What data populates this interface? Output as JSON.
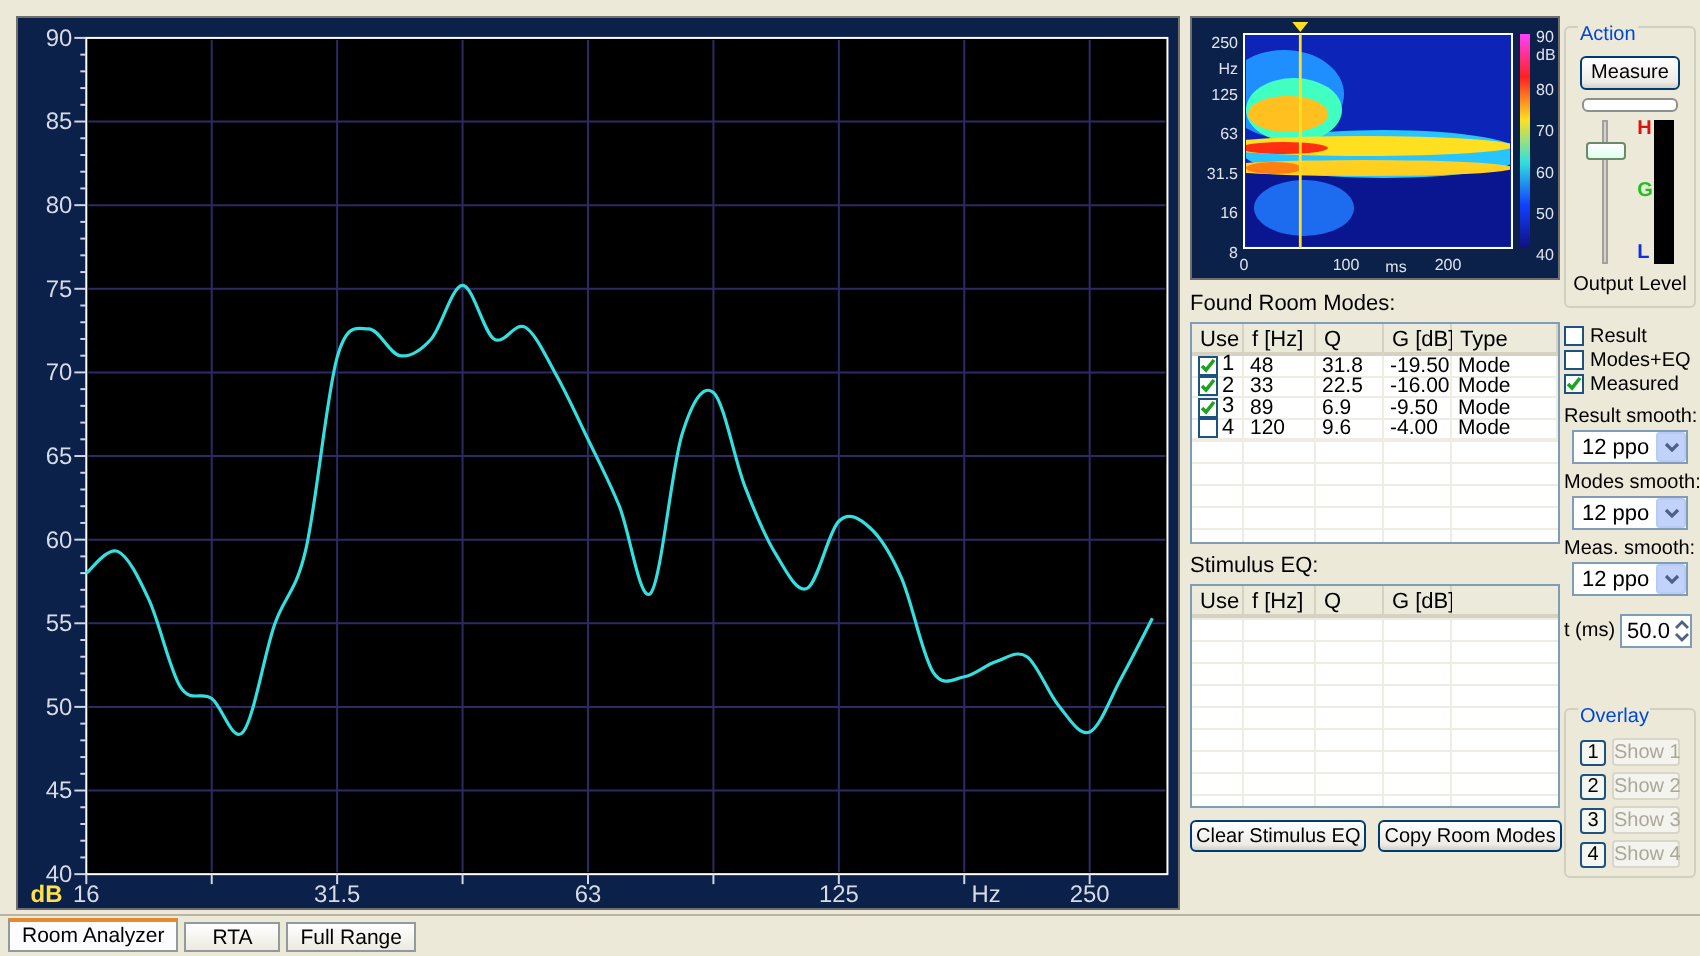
{
  "chart": {
    "chart_data": {
      "type": "line",
      "grid": true,
      "xlabel": "Hz",
      "ylabel": "dB",
      "ylim": [
        40,
        90
      ],
      "yticks": [
        40,
        45,
        50,
        55,
        60,
        65,
        70,
        75,
        80,
        85,
        90
      ],
      "categories": [
        "16",
        null,
        null,
        null,
        null,
        null,
        null,
        null,
        "31.5",
        null,
        null,
        null,
        null,
        null,
        null,
        null,
        "63",
        null,
        null,
        null,
        null,
        null,
        null,
        null,
        "125",
        null,
        null,
        null,
        null,
        null,
        null,
        null,
        "250",
        null,
        null
      ],
      "series": [
        {
          "color": "#33e0e0",
          "values": [
            58,
            59.3,
            56.4,
            51.2,
            50.5,
            48.5,
            54.9,
            59.4,
            70.9,
            72.6,
            71,
            72,
            75.2,
            72,
            72.7,
            69.8,
            66,
            62,
            56.8,
            66.3,
            68.8,
            63.2,
            59.1,
            57.1,
            61.1,
            60.7,
            57.7,
            52.1,
            51.8,
            52.7,
            53,
            50.1,
            48.5,
            51.7,
            55.3
          ]
        }
      ]
    }
  },
  "spectrogram": {
    "y_unit": "Hz",
    "y_ticks": [
      "250",
      "125",
      "63",
      "31.5",
      "16",
      "8"
    ],
    "x_ticks": [
      "0",
      "100",
      "200"
    ],
    "x_unit": "ms",
    "colorbar_unit": "dB",
    "colorbar_ticks": [
      "90",
      "80",
      "70",
      "60",
      "50",
      "40"
    ],
    "cursor": {
      "level": 0.21
    }
  },
  "found_modes": {
    "title": "Found Room Modes:",
    "columns": [
      "Use",
      "f [Hz]",
      "Q",
      "G [dB]",
      "Type"
    ],
    "rows": [
      {
        "checked": true,
        "use": "1",
        "f": "48",
        "q": "31.8",
        "g": "-19.50",
        "type": "Mode"
      },
      {
        "checked": true,
        "use": "2",
        "f": "33",
        "q": "22.5",
        "g": "-16.00",
        "type": "Mode"
      },
      {
        "checked": true,
        "use": "3",
        "f": "89",
        "q": "6.9",
        "g": "-9.50",
        "type": "Mode"
      },
      {
        "checked": false,
        "use": "4",
        "f": "120",
        "q": "9.6",
        "g": "-4.00",
        "type": "Mode"
      }
    ]
  },
  "stimulus_eq": {
    "title": "Stimulus EQ:",
    "columns": [
      "Use",
      "f [Hz]",
      "Q",
      "G [dB]"
    ]
  },
  "buttons": [
    "Clear Stimulus EQ",
    "Copy Room Modes"
  ],
  "action": {
    "title": "Action",
    "measure_button": "Measure",
    "progress": {
      "level": 0
    }
  },
  "output_level": {
    "label": "Output Level",
    "meter_labels": [
      "H",
      "G",
      "L"
    ],
    "slider": {
      "level": 0.82
    },
    "meter": {
      "level": 0
    }
  },
  "views": [
    {
      "label": "Result",
      "checked": false
    },
    {
      "label": "Modes+EQ",
      "checked": false
    },
    {
      "label": "Measured",
      "checked": true
    }
  ],
  "smoothing": [
    {
      "label": "Result smooth:",
      "value": "12 ppo"
    },
    {
      "label": "Modes smooth:",
      "value": "12 ppo"
    },
    {
      "label": "Meas. smooth:",
      "value": "12 ppo"
    }
  ],
  "time": {
    "label": "t (ms)",
    "value": "50.0"
  },
  "overlay": {
    "title": "Overlay",
    "items": [
      {
        "number": "1",
        "label": "Show 1",
        "disabled": true
      },
      {
        "number": "2",
        "label": "Show 2",
        "disabled": true
      },
      {
        "number": "3",
        "label": "Show 3",
        "disabled": true
      },
      {
        "number": "4",
        "label": "Show 4",
        "disabled": true
      }
    ]
  },
  "tabs": [
    {
      "label": "Room Analyzer",
      "selected": true
    },
    {
      "label": "RTA",
      "selected": false
    },
    {
      "label": "Full Range",
      "selected": false
    }
  ]
}
